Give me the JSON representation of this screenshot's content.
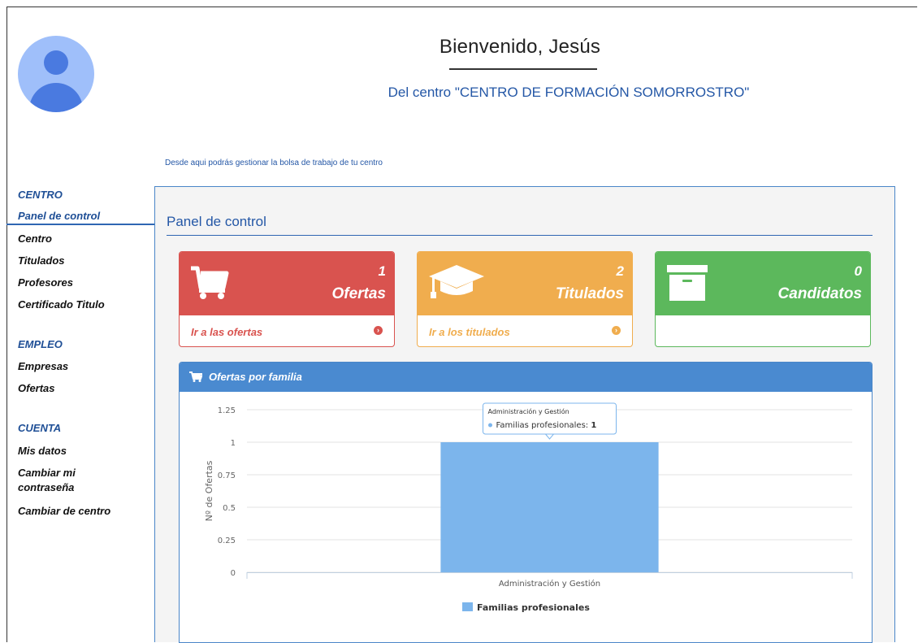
{
  "header": {
    "welcome": "Bienvenido, Jesús",
    "centro": "Del centro \"CENTRO DE FORMACIÓN SOMORROSTRO\"",
    "intro": "Desde aqui podrás gestionar la bolsa de trabajo de tu centro"
  },
  "sidebar": {
    "sections": [
      {
        "heading": "CENTRO",
        "items": [
          "Panel de control",
          "Centro",
          "Titulados",
          "Profesores",
          "Certificado Titulo"
        ]
      },
      {
        "heading": "EMPLEO",
        "items": [
          "Empresas",
          "Ofertas"
        ]
      },
      {
        "heading": "CUENTA",
        "items": [
          "Mis datos",
          "Cambiar mi contraseña",
          "Cambiar de centro"
        ]
      }
    ],
    "active": "Panel de control"
  },
  "main": {
    "title": "Panel de control",
    "cards": [
      {
        "count": "1",
        "label": "Ofertas",
        "link": "Ir a las ofertas",
        "color": "#d9534f",
        "icon": "shopping-cart-icon"
      },
      {
        "count": "2",
        "label": "Titulados",
        "link": "Ir a los titulados",
        "color": "#f0ad4e",
        "icon": "graduation-cap-icon"
      },
      {
        "count": "0",
        "label": "Candidatos",
        "link": "",
        "color": "#5cb85c",
        "icon": "archive-box-icon"
      }
    ],
    "chart_panel_title": "Ofertas por familia"
  },
  "chart_data": {
    "type": "bar",
    "categories": [
      "Administración y Gestión"
    ],
    "series": [
      {
        "name": "Familias profesionales",
        "values": [
          1
        ],
        "color": "#7cb5ec"
      }
    ],
    "ylabel": "Nº de Ofertas",
    "ylim": [
      0,
      1.25
    ],
    "yticks": [
      "0",
      "0.25",
      "0.5",
      "0.75",
      "1",
      "1.25"
    ],
    "grid": true,
    "legend": "bottom",
    "tooltip": {
      "title": "Administración y Gestión",
      "series": "Familias profesionales",
      "value": "1"
    }
  }
}
